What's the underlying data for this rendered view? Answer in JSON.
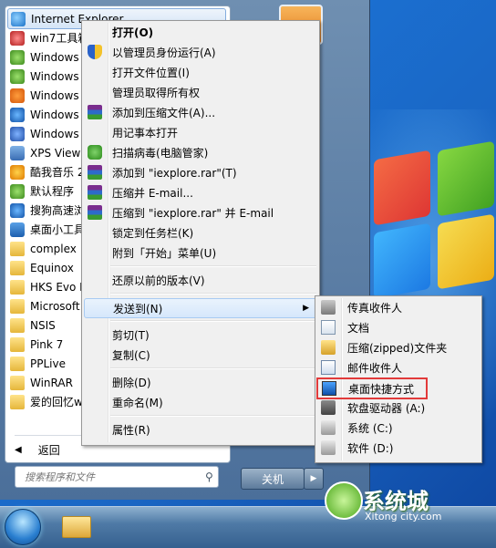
{
  "programs": [
    {
      "label": "Internet Explorer",
      "icon": "internet-explorer-icon"
    },
    {
      "label": "win7工具箱",
      "icon": "toolbox-icon"
    },
    {
      "label": "Windows",
      "icon": "media-player-icon"
    },
    {
      "label": "Windows",
      "icon": "media-center-icon"
    },
    {
      "label": "Windows",
      "icon": "media-player-icon"
    },
    {
      "label": "Windows",
      "icon": "update-icon"
    },
    {
      "label": "Windows",
      "icon": "dvd-maker-icon"
    },
    {
      "label": "XPS Viewe",
      "icon": "xps-viewer-icon"
    },
    {
      "label": "酷我音乐 2",
      "icon": "music-icon"
    },
    {
      "label": "默认程序",
      "icon": "default-programs-icon"
    },
    {
      "label": "搜狗高速浏",
      "icon": "browser-icon"
    },
    {
      "label": "桌面小工具",
      "icon": "gadget-icon"
    },
    {
      "label": "complex",
      "icon": "folder-icon"
    },
    {
      "label": "Equinox",
      "icon": "folder-icon"
    },
    {
      "label": "HKS Evo R",
      "icon": "folder-icon"
    },
    {
      "label": "Microsoft",
      "icon": "folder-icon"
    },
    {
      "label": "NSIS",
      "icon": "folder-icon"
    },
    {
      "label": "Pink 7",
      "icon": "folder-icon"
    },
    {
      "label": "PPLive",
      "icon": "folder-icon"
    },
    {
      "label": "WinRAR",
      "icon": "folder-icon"
    },
    {
      "label": "爱的回忆wi",
      "icon": "folder-icon"
    }
  ],
  "back_label": "返回",
  "search_placeholder": "搜索程序和文件",
  "shutdown_label": "关机",
  "context_menu": [
    {
      "label": "打开(O)",
      "bold": true
    },
    {
      "label": "以管理员身份运行(A)",
      "icon": "shield"
    },
    {
      "label": "打开文件位置(I)"
    },
    {
      "label": "管理员取得所有权"
    },
    {
      "label": "添加到压缩文件(A)...",
      "icon": "rar"
    },
    {
      "label": "用记事本打开"
    },
    {
      "label": "扫描病毒(电脑管家)",
      "icon": "scan"
    },
    {
      "label": "添加到 \"iexplore.rar\"(T)",
      "icon": "rar"
    },
    {
      "label": "压缩并 E-mail...",
      "icon": "rar"
    },
    {
      "label": "压缩到 \"iexplore.rar\" 并 E-mail",
      "icon": "rar"
    },
    {
      "label": "锁定到任务栏(K)"
    },
    {
      "label": "附到「开始」菜单(U)"
    },
    {
      "label": "还原以前的版本(V)"
    },
    {
      "label": "发送到(N)",
      "submenu": true
    },
    {
      "label": "剪切(T)"
    },
    {
      "label": "复制(C)"
    },
    {
      "label": "删除(D)"
    },
    {
      "label": "重命名(M)"
    },
    {
      "label": "属性(R)"
    }
  ],
  "send_to": [
    {
      "label": "传真收件人"
    },
    {
      "label": "文档"
    },
    {
      "label": "压缩(zipped)文件夹"
    },
    {
      "label": "邮件收件人"
    },
    {
      "label": "桌面快捷方式"
    },
    {
      "label": "软盘驱动器 (A:)"
    },
    {
      "label": "系统 (C:)"
    },
    {
      "label": "软件 (D:)"
    }
  ],
  "watermark": {
    "cn": "系统城",
    "en": "Xitong city.com"
  }
}
